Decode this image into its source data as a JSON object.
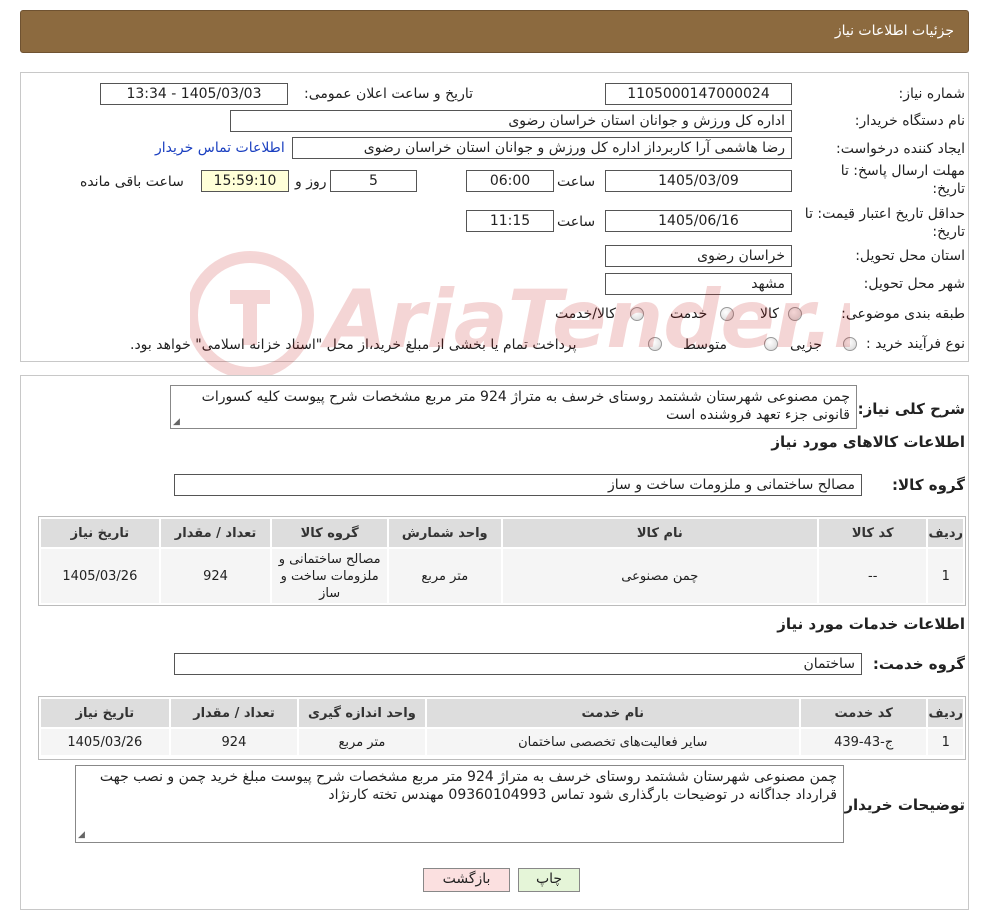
{
  "header": {
    "title": "جزئیات اطلاعات نیاز"
  },
  "info": {
    "need_number_label": "شماره نیاز:",
    "need_number": "1105000147000024",
    "announce_label": "تاریخ و ساعت اعلان عمومی:",
    "announce_value": "1405/03/03 - 13:34",
    "buyer_org_label": "نام دستگاه خریدار:",
    "buyer_org": "اداره کل ورزش و جوانان استان خراسان رضوی",
    "requester_label": "ایجاد کننده درخواست:",
    "requester": "رضا هاشمی آرا کاربرداز اداره کل ورزش و جوانان استان خراسان رضوی",
    "contact_link": "اطلاعات تماس خریدار",
    "deadline_label_1": "مهلت ارسال پاسخ: تا",
    "deadline_label_2": "تاریخ:",
    "deadline_date": "1405/03/09",
    "time_label": "ساعت",
    "deadline_time": "06:00",
    "days": "5",
    "days_label": "روز و",
    "remaining": "15:59:10",
    "remaining_label": "ساعت باقی مانده",
    "validity_label_1": "حداقل تاریخ اعتبار قیمت: تا",
    "validity_label_2": "تاریخ:",
    "validity_date": "1405/06/16",
    "validity_time": "11:15",
    "province_label": "استان محل تحویل:",
    "province": "خراسان رضوی",
    "city_label": "شهر محل تحویل:",
    "city": "مشهد",
    "category_label": "طبقه بندی موضوعی:",
    "category_options": [
      "کالا",
      "خدمت",
      "کالا/خدمت"
    ],
    "process_label": "نوع فرآیند خرید :",
    "process_options": [
      "جزیی",
      "متوسط"
    ],
    "process_note": "پرداخت تمام یا بخشی از مبلغ خرید،از محل \"اسناد خزانه اسلامی\" خواهد بود."
  },
  "description": {
    "label": "شرح کلی نیاز:",
    "text": "چمن مصنوعی شهرستان ششتمد روستای خرسف به متراژ 924 متر مربع مشخصات شرح پیوست  کلیه کسورات قانونی جزء تعهد فروشنده است"
  },
  "goods": {
    "section_title": "اطلاعات کالاهای مورد نیاز",
    "group_label": "گروه کالا:",
    "group_value": "مصالح ساختمانی و ملزومات ساخت و ساز",
    "columns": [
      "ردیف",
      "کد کالا",
      "نام کالا",
      "واحد شمارش",
      "گروه کالا",
      "تعداد / مقدار",
      "تاریخ نیاز"
    ],
    "rows": [
      [
        "1",
        "--",
        "چمن مصنوعی",
        "متر مربع",
        "مصالح ساختمانی و ملزومات ساخت و ساز",
        "924",
        "1405/03/26"
      ]
    ]
  },
  "services": {
    "section_title": "اطلاعات خدمات مورد نیاز",
    "group_label": "گروه خدمت:",
    "group_value": "ساختمان",
    "columns": [
      "ردیف",
      "کد خدمت",
      "نام خدمت",
      "واحد اندازه گیری",
      "تعداد / مقدار",
      "تاریخ نیاز"
    ],
    "rows": [
      [
        "1",
        "ج-43-439",
        "سایر فعالیت‌های تخصصی ساختمان",
        "متر مربع",
        "924",
        "1405/03/26"
      ]
    ]
  },
  "buyer_notes": {
    "label": "توضیحات خریدار:",
    "text": "چمن مصنوعی شهرستان ششتمد روستای خرسف به متراژ 924 متر مربع  مشخصات شرح پیوست مبلغ خرید چمن و نصب جهت قرارداد جداگانه در توضیحات بارگذاری شود تماس 09360104993 مهندس تخته کارنژاد"
  },
  "buttons": {
    "print": "چاپ",
    "back": "بازگشت"
  },
  "watermark": {
    "text": "AriaTender.neT"
  },
  "colors": {
    "header_bg": "#8c6a3f",
    "link": "#1a3fc0",
    "back_button_bg": "#fbe0e0",
    "print_button_bg": "#e5f5d8",
    "remaining_bg": "#ffffd8"
  }
}
